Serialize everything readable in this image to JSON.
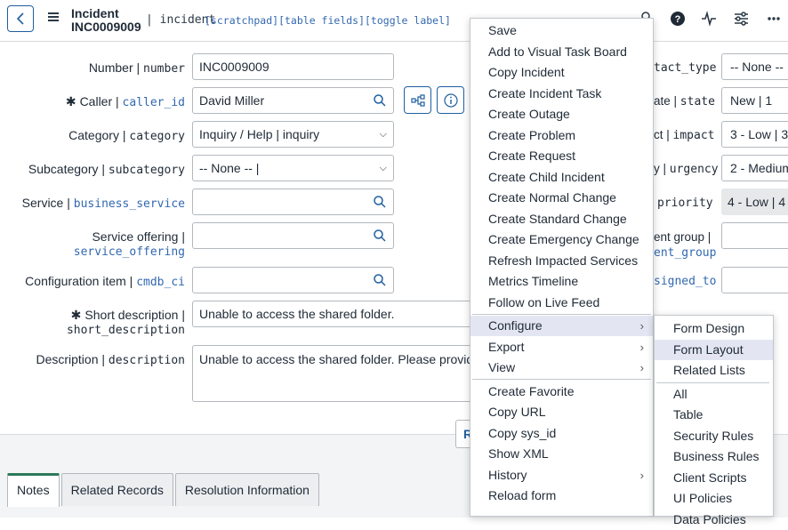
{
  "header": {
    "title_line1": "Incident",
    "title_line2": "INC0009009",
    "table_name": "| incident",
    "links": "[scratchpad][table fields][toggle label]"
  },
  "form": {
    "number_label": "Number |",
    "number_field": "number",
    "number_value": "INC0009009",
    "caller_required": "✱",
    "caller_label": "Caller |",
    "caller_field": "caller_id",
    "caller_value": "David Miller",
    "category_label": "Category |",
    "category_field": "category",
    "category_value": "Inquiry / Help | inquiry",
    "subcategory_label": "Subcategory |",
    "subcategory_field": "subcategory",
    "subcategory_value": "-- None -- |",
    "service_label": "Service |",
    "service_field": "business_service",
    "service_value": "",
    "offering_label": "Service offering |",
    "offering_field": "service_offering",
    "offering_value": "",
    "ci_label": "Configuration item |",
    "ci_field": "cmdb_ci",
    "ci_value": "",
    "short_desc_required": "✱",
    "short_desc_label": "Short description |",
    "short_desc_field": "short_description",
    "short_desc_value": "Unable to access the shared folder.",
    "desc_label": "Description |",
    "desc_field": "description",
    "desc_value": "Unable to access the shared folder. Please provide",
    "partial_button": "R"
  },
  "right_col": {
    "contact_label": "tact_type",
    "contact_value": "-- None -- |",
    "state_label_a": "ate |",
    "state_label_b": "state",
    "state_value": "New | 1",
    "impact_label_a": "ct |",
    "impact_label_b": "impact",
    "impact_value": "3 - Low | 3",
    "urgency_label_a": "y |",
    "urgency_label_b": "urgency",
    "urgency_value": "2 - Medium",
    "priority_label": "priority",
    "priority_value": "4 - Low | 4",
    "group_label_a": "ent group |",
    "group_label_b": "ent_group",
    "assigned_label": "signed_to"
  },
  "tabs": [
    "Notes",
    "Related Records",
    "Resolution Information"
  ],
  "context_menu": {
    "items": [
      "Save",
      "Add to Visual Task Board",
      "Copy Incident",
      "Create Incident Task",
      "Create Outage",
      "Create Problem",
      "Create Request",
      "Create Child Incident",
      "Create Normal Change",
      "Create Standard Change",
      "Create Emergency Change",
      "Refresh Impacted Services",
      "Metrics Timeline",
      "Follow on Live Feed"
    ],
    "sub_items": [
      "Configure",
      "Export",
      "View"
    ],
    "items2": [
      "Create Favorite",
      "Copy URL",
      "Copy sys_id",
      "Show XML",
      "History",
      "Reload form"
    ],
    "arrow": "›"
  },
  "configure_submenu": {
    "items": [
      "Form Design",
      "Form Layout",
      "Related Lists"
    ],
    "items2": [
      "All",
      "Table",
      "Security Rules",
      "Business Rules",
      "Client Scripts",
      "UI Policies",
      "Data Policies"
    ]
  },
  "icons": [
    "back-icon",
    "menu-icon",
    "search-icon",
    "help-icon",
    "activity-icon",
    "settings-icon",
    "more-icon",
    "hierarchy-icon",
    "info-icon"
  ],
  "colors": {
    "accent": "#1f5f9f",
    "link": "#3268b0",
    "highlight": "#e3e6f2",
    "tab_active": "#2c7a5a"
  }
}
